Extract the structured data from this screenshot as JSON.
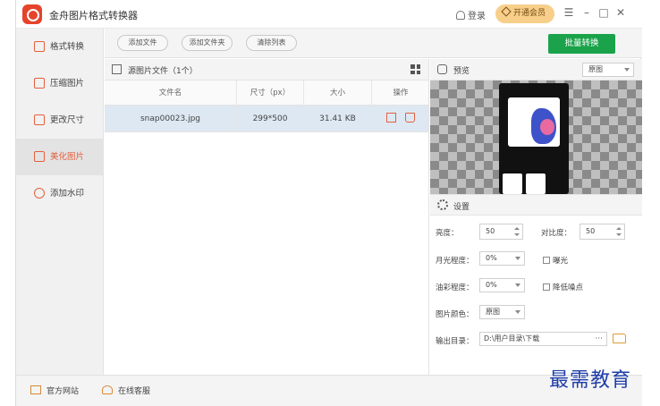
{
  "app": {
    "title": "金舟图片格式转换器"
  },
  "titlebar": {
    "login": "登录",
    "vip": "开通会员"
  },
  "sidebar": {
    "items": [
      {
        "label": "格式转换",
        "icon": "format-icon",
        "active": false
      },
      {
        "label": "压缩图片",
        "icon": "compress-icon",
        "active": false
      },
      {
        "label": "更改尺寸",
        "icon": "resize-icon",
        "active": false
      },
      {
        "label": "美化图片",
        "icon": "beautify-icon",
        "active": true
      },
      {
        "label": "添加水印",
        "icon": "watermark-icon",
        "active": false
      }
    ]
  },
  "toolbar": {
    "add_file": "添加文件",
    "add_folder": "添加文件夹",
    "clear_list": "清除列表",
    "batch_convert": "批量转换"
  },
  "file_panel": {
    "title": "源图片文件（1个）",
    "columns": [
      "文件名",
      "尺寸（px）",
      "大小",
      "操作"
    ],
    "rows": [
      {
        "name": "snap00023.jpg",
        "size_px": "299*500",
        "file_size": "31.41 KB"
      }
    ]
  },
  "preview": {
    "title": "预览",
    "mode_select": "原图"
  },
  "settings": {
    "title": "设置",
    "brightness_label": "亮度：",
    "brightness_value": "50",
    "contrast_label": "对比度：",
    "contrast_value": "50",
    "moonlight_label": "月光程度：",
    "moonlight_value": "0%",
    "exposure_label": "曝光",
    "oil_label": "油彩程度：",
    "oil_value": "0%",
    "denoise_label": "降低噪点",
    "color_label": "图片颜色：",
    "color_value": "原图",
    "output_label": "输出目录：",
    "output_value": "D:\\用户目录\\下载",
    "output_more": "···"
  },
  "bottombar": {
    "website": "官方网站",
    "support": "在线客服"
  },
  "watermark": "最需教育",
  "colors": {
    "accent": "#e3603f",
    "primary_button": "#1aa34a",
    "selected_row": "#dde8f2"
  }
}
